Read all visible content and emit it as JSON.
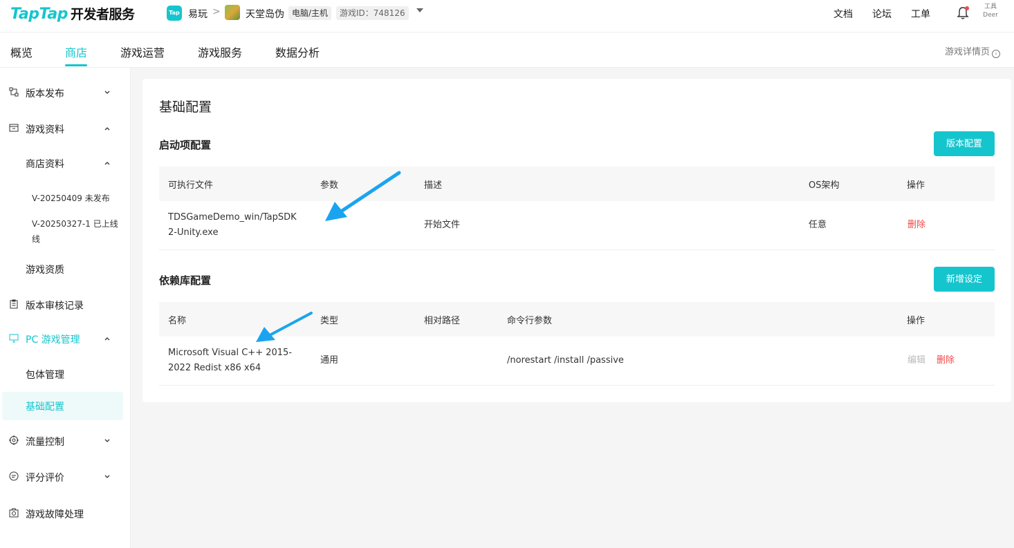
{
  "header": {
    "logo_en": "TapTap",
    "logo_cn": "开发者服务",
    "app_badge": "Tap",
    "app_name": "易玩",
    "separator": ">",
    "game_name": "天堂岛伪",
    "platform_tag": "电脑/主机",
    "game_id": "游戏ID：748126",
    "links": [
      "文档",
      "论坛",
      "工单"
    ],
    "avatar_text_1": "工具",
    "avatar_text_2": "Deer"
  },
  "tabs": {
    "items": [
      "概览",
      "商店",
      "游戏运营",
      "游戏服务",
      "数据分析"
    ],
    "active": "商店",
    "detail_link": "游戏详情页"
  },
  "sidebar": {
    "items": [
      {
        "label": "版本发布",
        "icon": "flow-icon",
        "chevron": "down"
      },
      {
        "label": "游戏资料",
        "icon": "archive-icon",
        "chevron": "up"
      },
      {
        "label": "商店资料",
        "chevron": "up"
      },
      {
        "label": "V-20250409 未发布"
      },
      {
        "label": "V-20250327-1 已上线"
      },
      {
        "label": "游戏资质"
      },
      {
        "label": "版本审核记录",
        "icon": "clipboard-icon"
      },
      {
        "label": "PC 游戏管理",
        "icon": "monitor-icon",
        "chevron": "up"
      },
      {
        "label": "包体管理"
      },
      {
        "label": "基础配置"
      },
      {
        "label": "流量控制",
        "icon": "target-icon",
        "chevron": "down"
      },
      {
        "label": "评分评价",
        "icon": "comment-icon",
        "chevron": "down"
      },
      {
        "label": "游戏故障处理",
        "icon": "camera-icon"
      }
    ],
    "version_line2": "线"
  },
  "content": {
    "title": "基础配置",
    "launch": {
      "title": "启动项配置",
      "button": "版本配置",
      "columns": [
        "可执行文件",
        "参数",
        "描述",
        "OS架构",
        "操作"
      ],
      "row": {
        "exe_line1": "TDSGameDemo_win/TapSDK",
        "exe_line2": "2-Unity.exe",
        "params": "",
        "desc": "开始文件",
        "os": "任意",
        "delete": "删除"
      }
    },
    "deps": {
      "title": "依赖库配置",
      "button": "新增设定",
      "columns": [
        "名称",
        "类型",
        "相对路径",
        "命令行参数",
        "操作"
      ],
      "row": {
        "name_line1": "Microsoft Visual C++ 2015-",
        "name_line2": "2022 Redist x86 x64",
        "type": "通用",
        "path": "",
        "args": "/norestart /install /passive",
        "edit": "编辑",
        "delete": "删除"
      }
    }
  },
  "colors": {
    "accent": "#15c5ce",
    "danger": "#f04848",
    "arrow": "#1aa4f0"
  }
}
